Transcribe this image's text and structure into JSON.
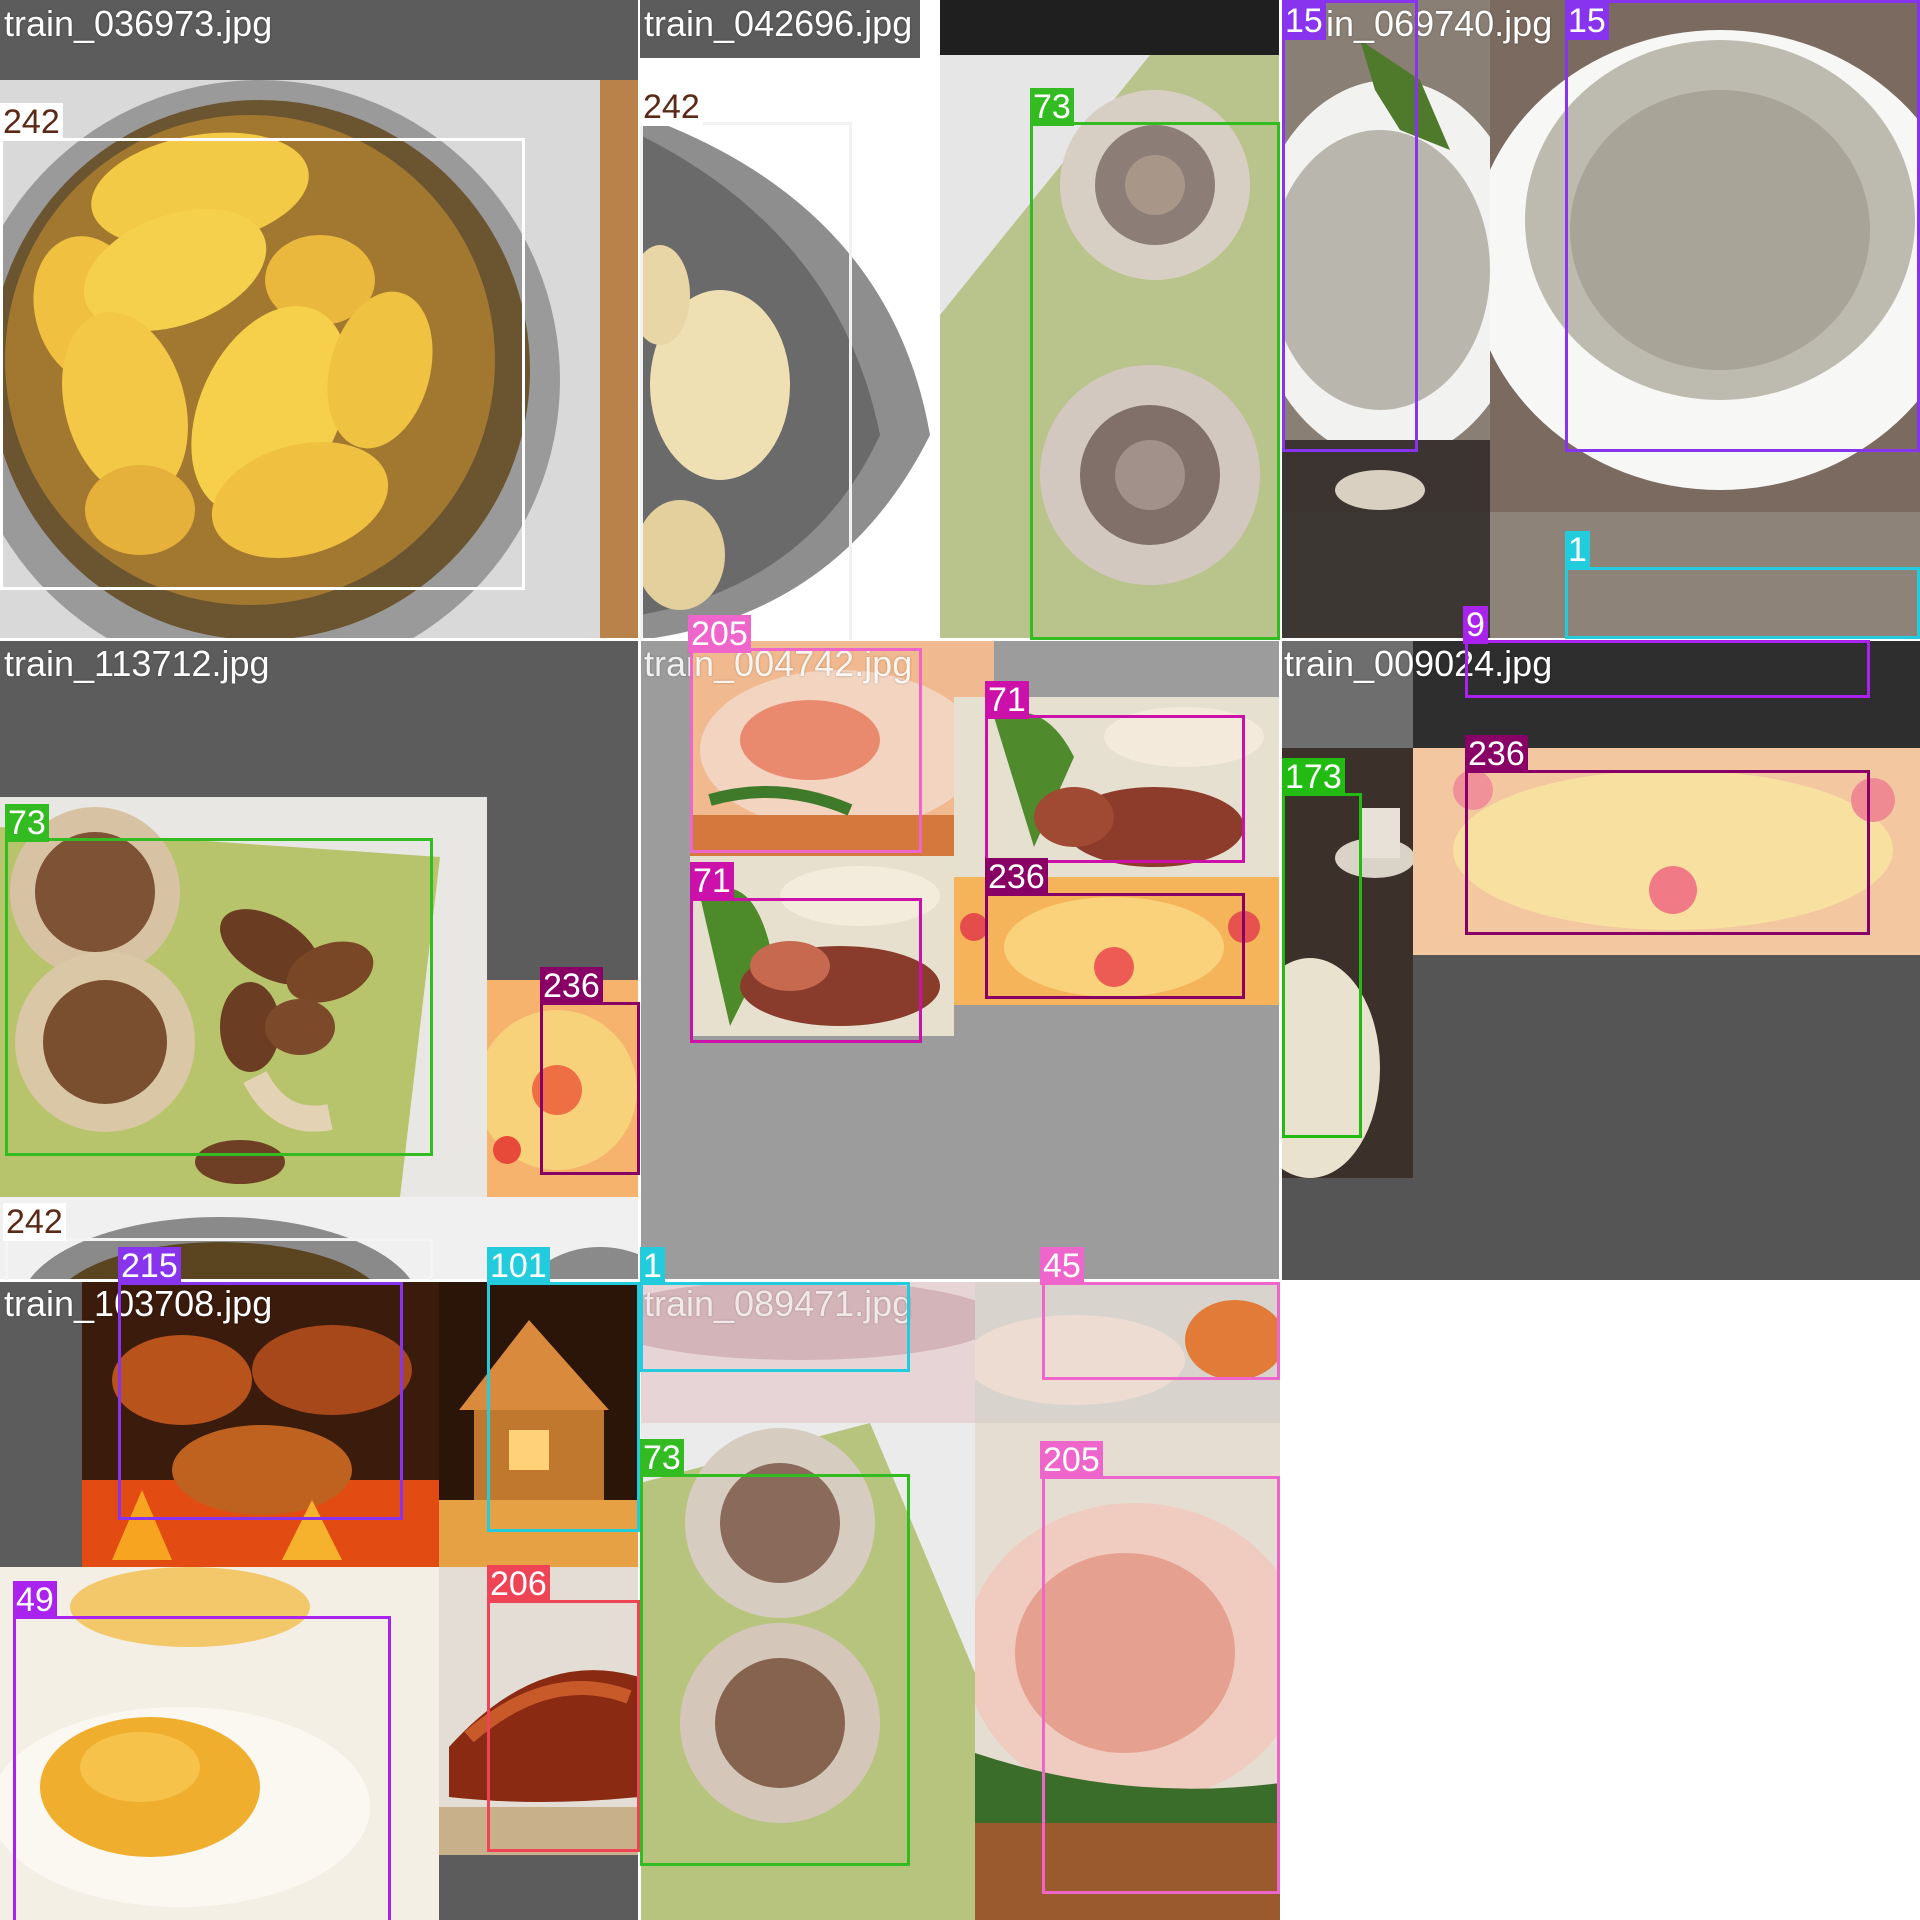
{
  "mosaic": {
    "tiles": [
      {
        "filename": "train_036973.jpg"
      },
      {
        "filename": "train_042696.jpg"
      },
      {
        "filename": "train_069740.jpg"
      },
      {
        "filename": "train_113712.jpg"
      },
      {
        "filename": "train_004742.jpg"
      },
      {
        "filename": "train_009024.jpg"
      },
      {
        "filename": "train_103708.jpg"
      },
      {
        "filename": "train_089471.jpg"
      }
    ],
    "labels": {
      "t1_242": "242",
      "t2_242": "242",
      "t2_73": "73",
      "t3_15a": "15",
      "t3_15b": "15",
      "t3_1": "1",
      "t3_9": "9",
      "t4_73": "73",
      "t4_236": "236",
      "t4_242": "242",
      "t5_205": "205",
      "t5_71a": "71",
      "t5_71b": "71",
      "t5_236": "236",
      "t6_173": "173",
      "t6_236": "236",
      "t7_215": "215",
      "t7_101": "101",
      "t7_49": "49",
      "t7_206": "206",
      "t8_1": "1",
      "t8_45": "45",
      "t8_73": "73",
      "t8_205": "205"
    }
  },
  "colors": {
    "class_242": "#ffffff",
    "class_73": "#33bb22",
    "class_15": "#8833ee",
    "class_1": "#22ccdd",
    "class_9": "#aa22ee",
    "class_236": "#880066",
    "class_205": "#ee66cc",
    "class_71": "#cc11aa",
    "class_173": "#22bb11",
    "class_215": "#8833ee",
    "class_101": "#22ccdd",
    "class_49": "#aa22ee",
    "class_206": "#ee4455",
    "class_45": "#ee66cc",
    "tile_background": "#5c5c5c"
  }
}
